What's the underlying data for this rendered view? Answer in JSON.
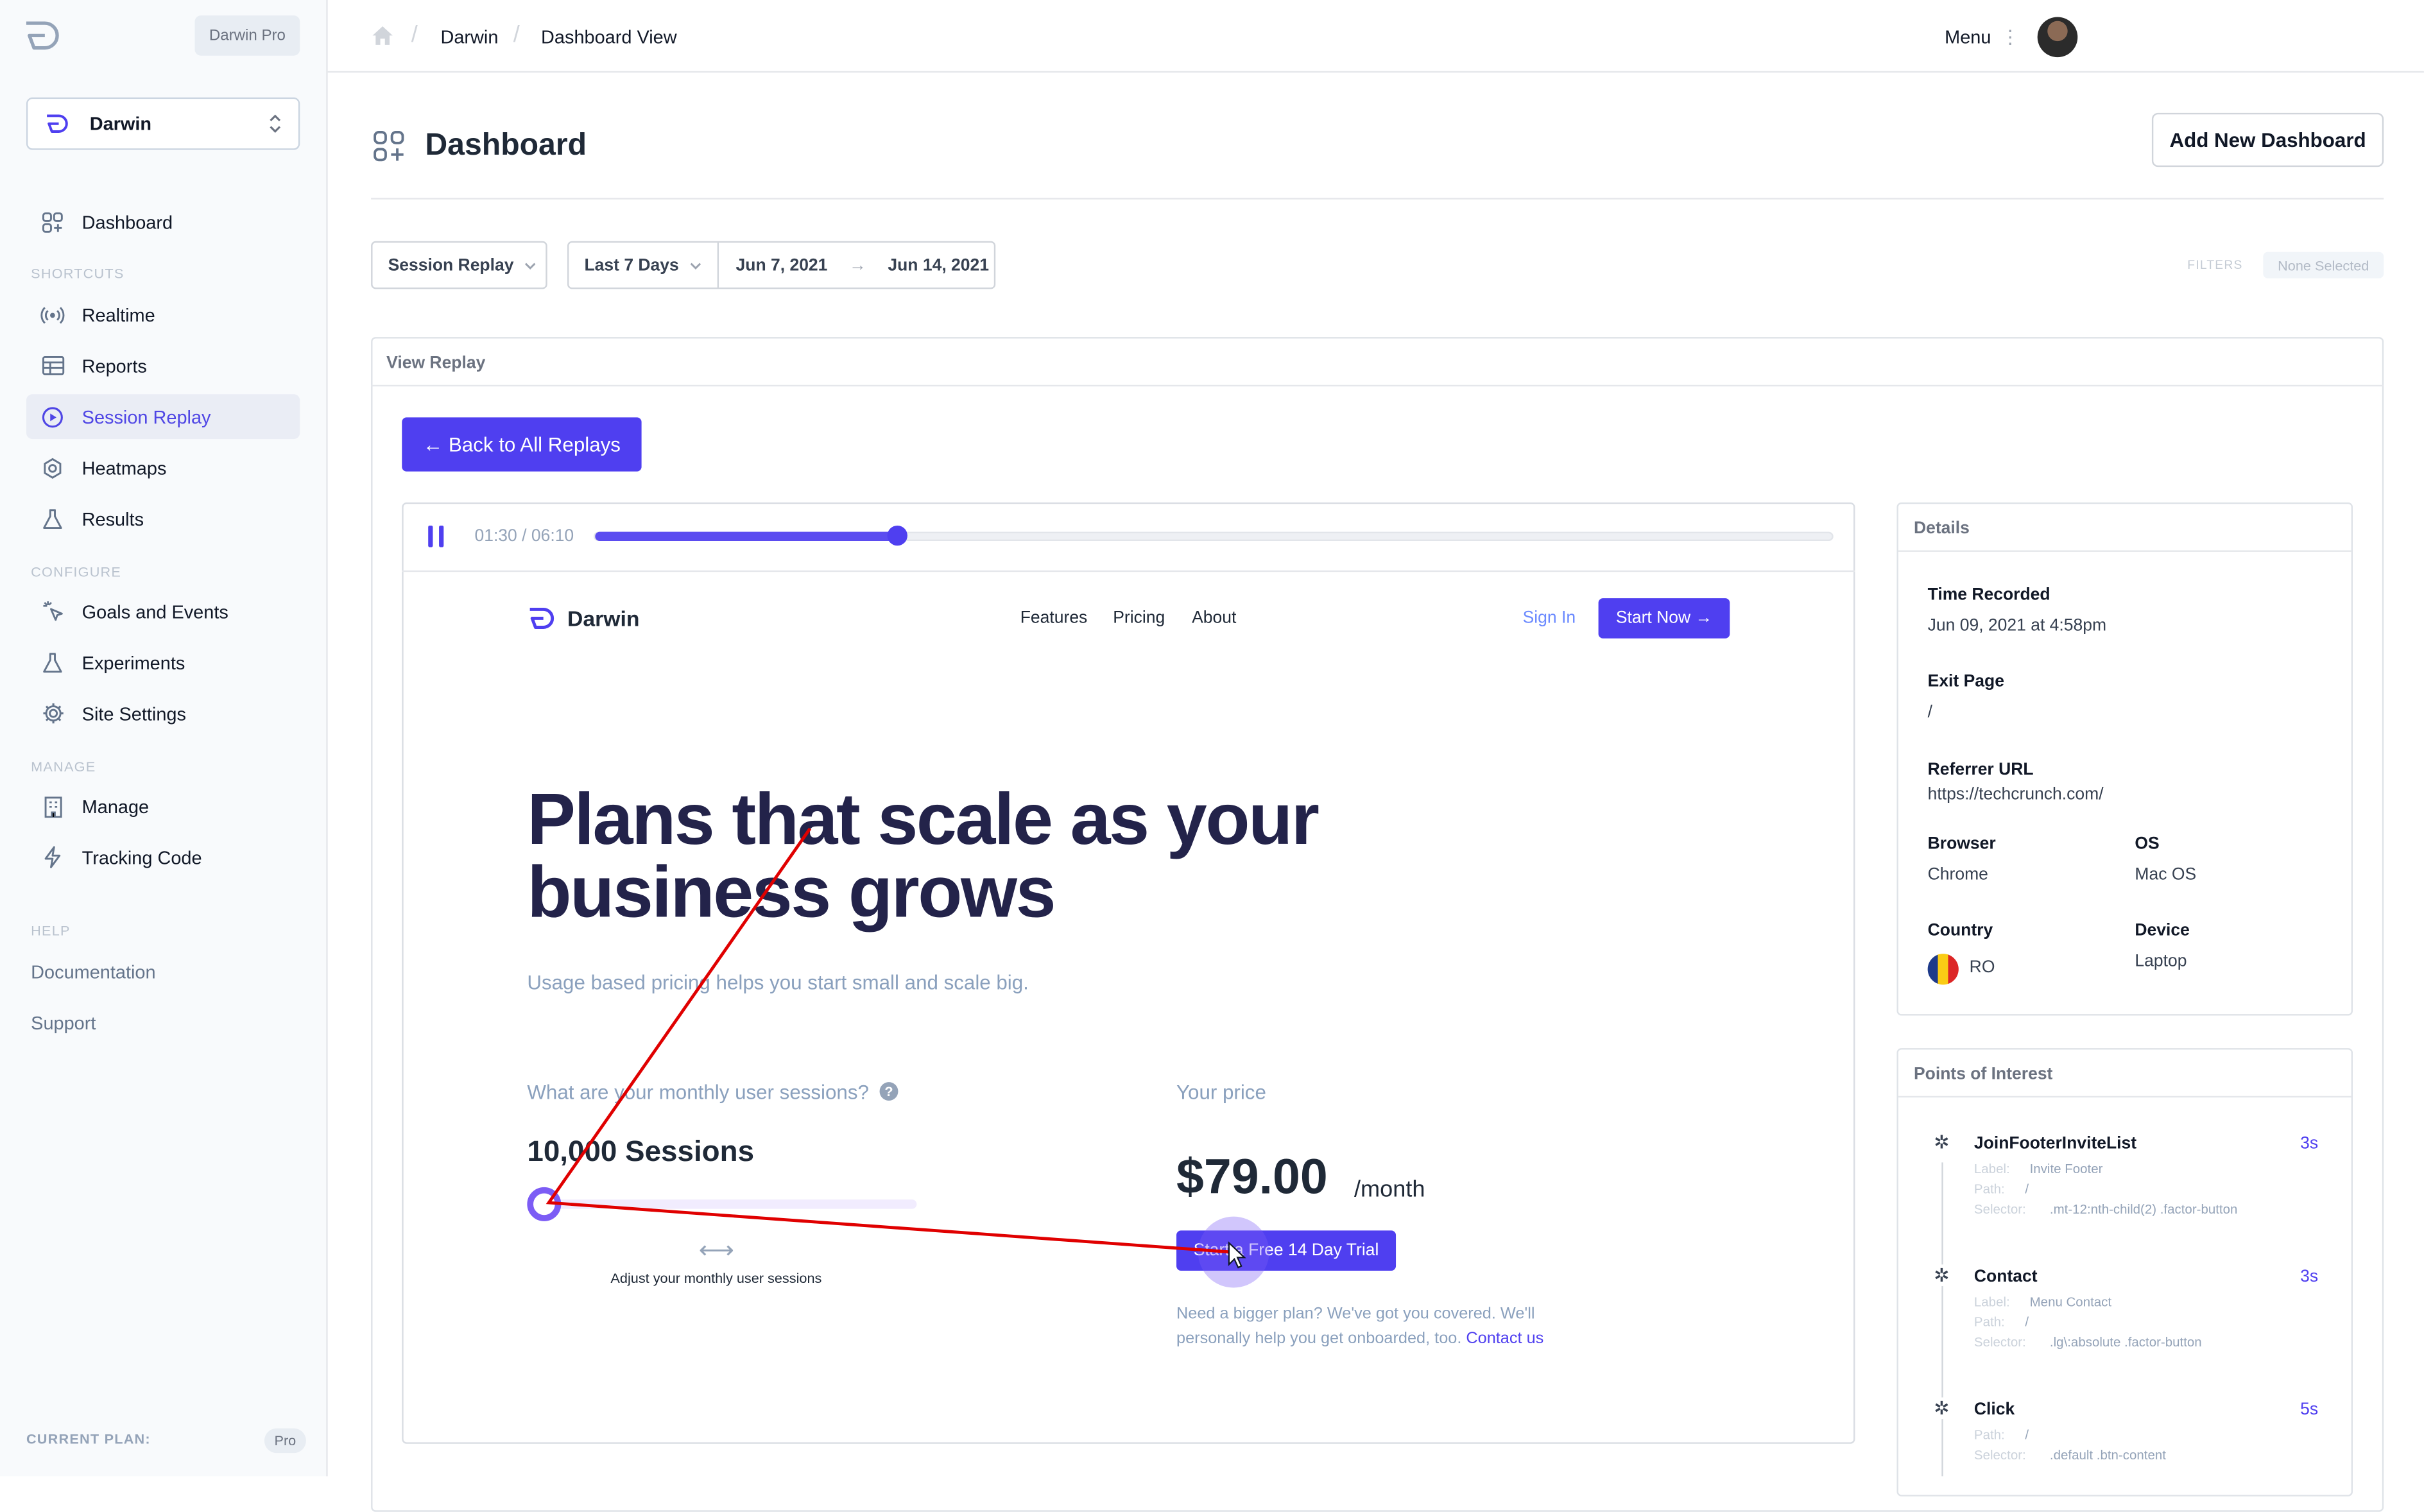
{
  "sidebar": {
    "plan_badge": "Darwin Pro",
    "site_selector": "Darwin",
    "items": [
      {
        "label": "Dashboard",
        "icon": "grid-icon"
      },
      {
        "label": "Realtime",
        "icon": "broadcast-icon"
      },
      {
        "label": "Reports",
        "icon": "table-icon"
      },
      {
        "label": "Session Replay",
        "icon": "play-circle-icon",
        "active": true
      },
      {
        "label": "Heatmaps",
        "icon": "target-icon"
      },
      {
        "label": "Results",
        "icon": "flask-icon"
      },
      {
        "label": "Goals and Events",
        "icon": "pointer-icon"
      },
      {
        "label": "Experiments",
        "icon": "flask-icon"
      },
      {
        "label": "Site Settings",
        "icon": "gear-icon"
      },
      {
        "label": "Manage",
        "icon": "building-icon"
      },
      {
        "label": "Tracking Code",
        "icon": "lightning-icon"
      }
    ],
    "sections": {
      "shortcuts": "SHORTCUTS",
      "configure": "CONFIGURE",
      "manage": "MANAGE",
      "help": "HELP"
    },
    "help_links": [
      "Documentation",
      "Support"
    ],
    "current_plan_label": "CURRENT PLAN:",
    "current_plan_value": "Pro"
  },
  "topbar": {
    "breadcrumbs": [
      "Darwin",
      "Dashboard View"
    ],
    "menu_label": "Menu"
  },
  "header": {
    "title": "Dashboard",
    "add_button": "Add New Dashboard"
  },
  "filters": {
    "report_type": "Session Replay",
    "range": "Last 7 Days",
    "date_from": "Jun 7, 2021",
    "date_to": "Jun 14, 2021",
    "filters_label": "FILTERS",
    "filters_value": "None Selected"
  },
  "panel": {
    "title": "View Replay",
    "back_button": "← Back to All Replays"
  },
  "player": {
    "time": "01:30 / 06:10",
    "progress": 0.245
  },
  "replay_page": {
    "logo": "Darwin",
    "nav": [
      "Features",
      "Pricing",
      "About"
    ],
    "sign_in": "Sign In",
    "start_now": "Start Now →",
    "headline": "Plans that scale as your business grows",
    "subheadline": "Usage based pricing helps you start small and scale big.",
    "sessions_question": "What are your monthly user sessions?",
    "sessions_value": "10,000 Sessions",
    "adjust_text": "Adjust your monthly user sessions",
    "price_label": "Your price",
    "price": "$79.00",
    "per": "/month",
    "trial_button": "Start a Free 14 Day Trial",
    "bigger_plan": "Need a bigger plan? We've got you covered. We'll personally help you get onboarded, too.",
    "contact": "Contact us"
  },
  "details": {
    "title": "Details",
    "time_recorded_label": "Time Recorded",
    "time_recorded": "Jun 09, 2021 at 4:58pm",
    "exit_page_label": "Exit Page",
    "exit_page": "/",
    "referrer_label": "Referrer URL",
    "referrer": "https://techcrunch.com/",
    "browser_label": "Browser",
    "browser": "Chrome",
    "os_label": "OS",
    "os": "Mac OS",
    "country_label": "Country",
    "country": "RO",
    "device_label": "Device",
    "device": "Laptop"
  },
  "poi": {
    "title": "Points of Interest",
    "items": [
      {
        "name": "JoinFooterInviteList",
        "duration": "3s",
        "label_k": "Label:",
        "label": "Invite Footer",
        "path_k": "Path:",
        "path": "/",
        "selector_k": "Selector:",
        "selector": ".mt-12:nth-child(2) .factor-button"
      },
      {
        "name": "Contact",
        "duration": "3s",
        "label_k": "Label:",
        "label": "Menu Contact",
        "path_k": "Path:",
        "path": "/",
        "selector_k": "Selector:",
        "selector": ".lg\\:absolute .factor-button"
      },
      {
        "name": "Click",
        "duration": "5s",
        "path_k": "Path:",
        "path": "/",
        "selector_k": "Selector:",
        "selector": ".default .btn-content"
      }
    ]
  },
  "colors": {
    "accent": "#4f3ff0",
    "cursor_path": "#e00000"
  }
}
